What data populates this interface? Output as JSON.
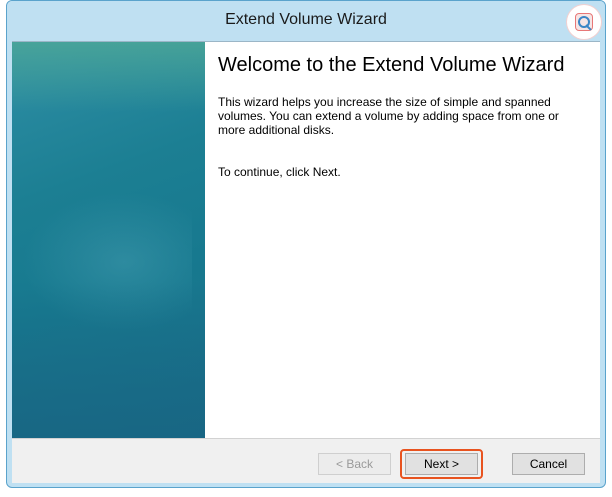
{
  "window": {
    "title": "Extend Volume Wizard"
  },
  "main": {
    "heading": "Welcome to the Extend Volume Wizard",
    "description": "This wizard helps you increase the size of simple and spanned volumes. You can extend a volume  by adding space from one or more additional disks.",
    "continue_text": "To continue, click Next."
  },
  "buttons": {
    "back_label": "< Back",
    "next_label": "Next >",
    "cancel_label": "Cancel"
  },
  "colors": {
    "titlebar": "#bfe0f2",
    "side_panel": "#1c7f93",
    "highlight": "#e8531f"
  }
}
